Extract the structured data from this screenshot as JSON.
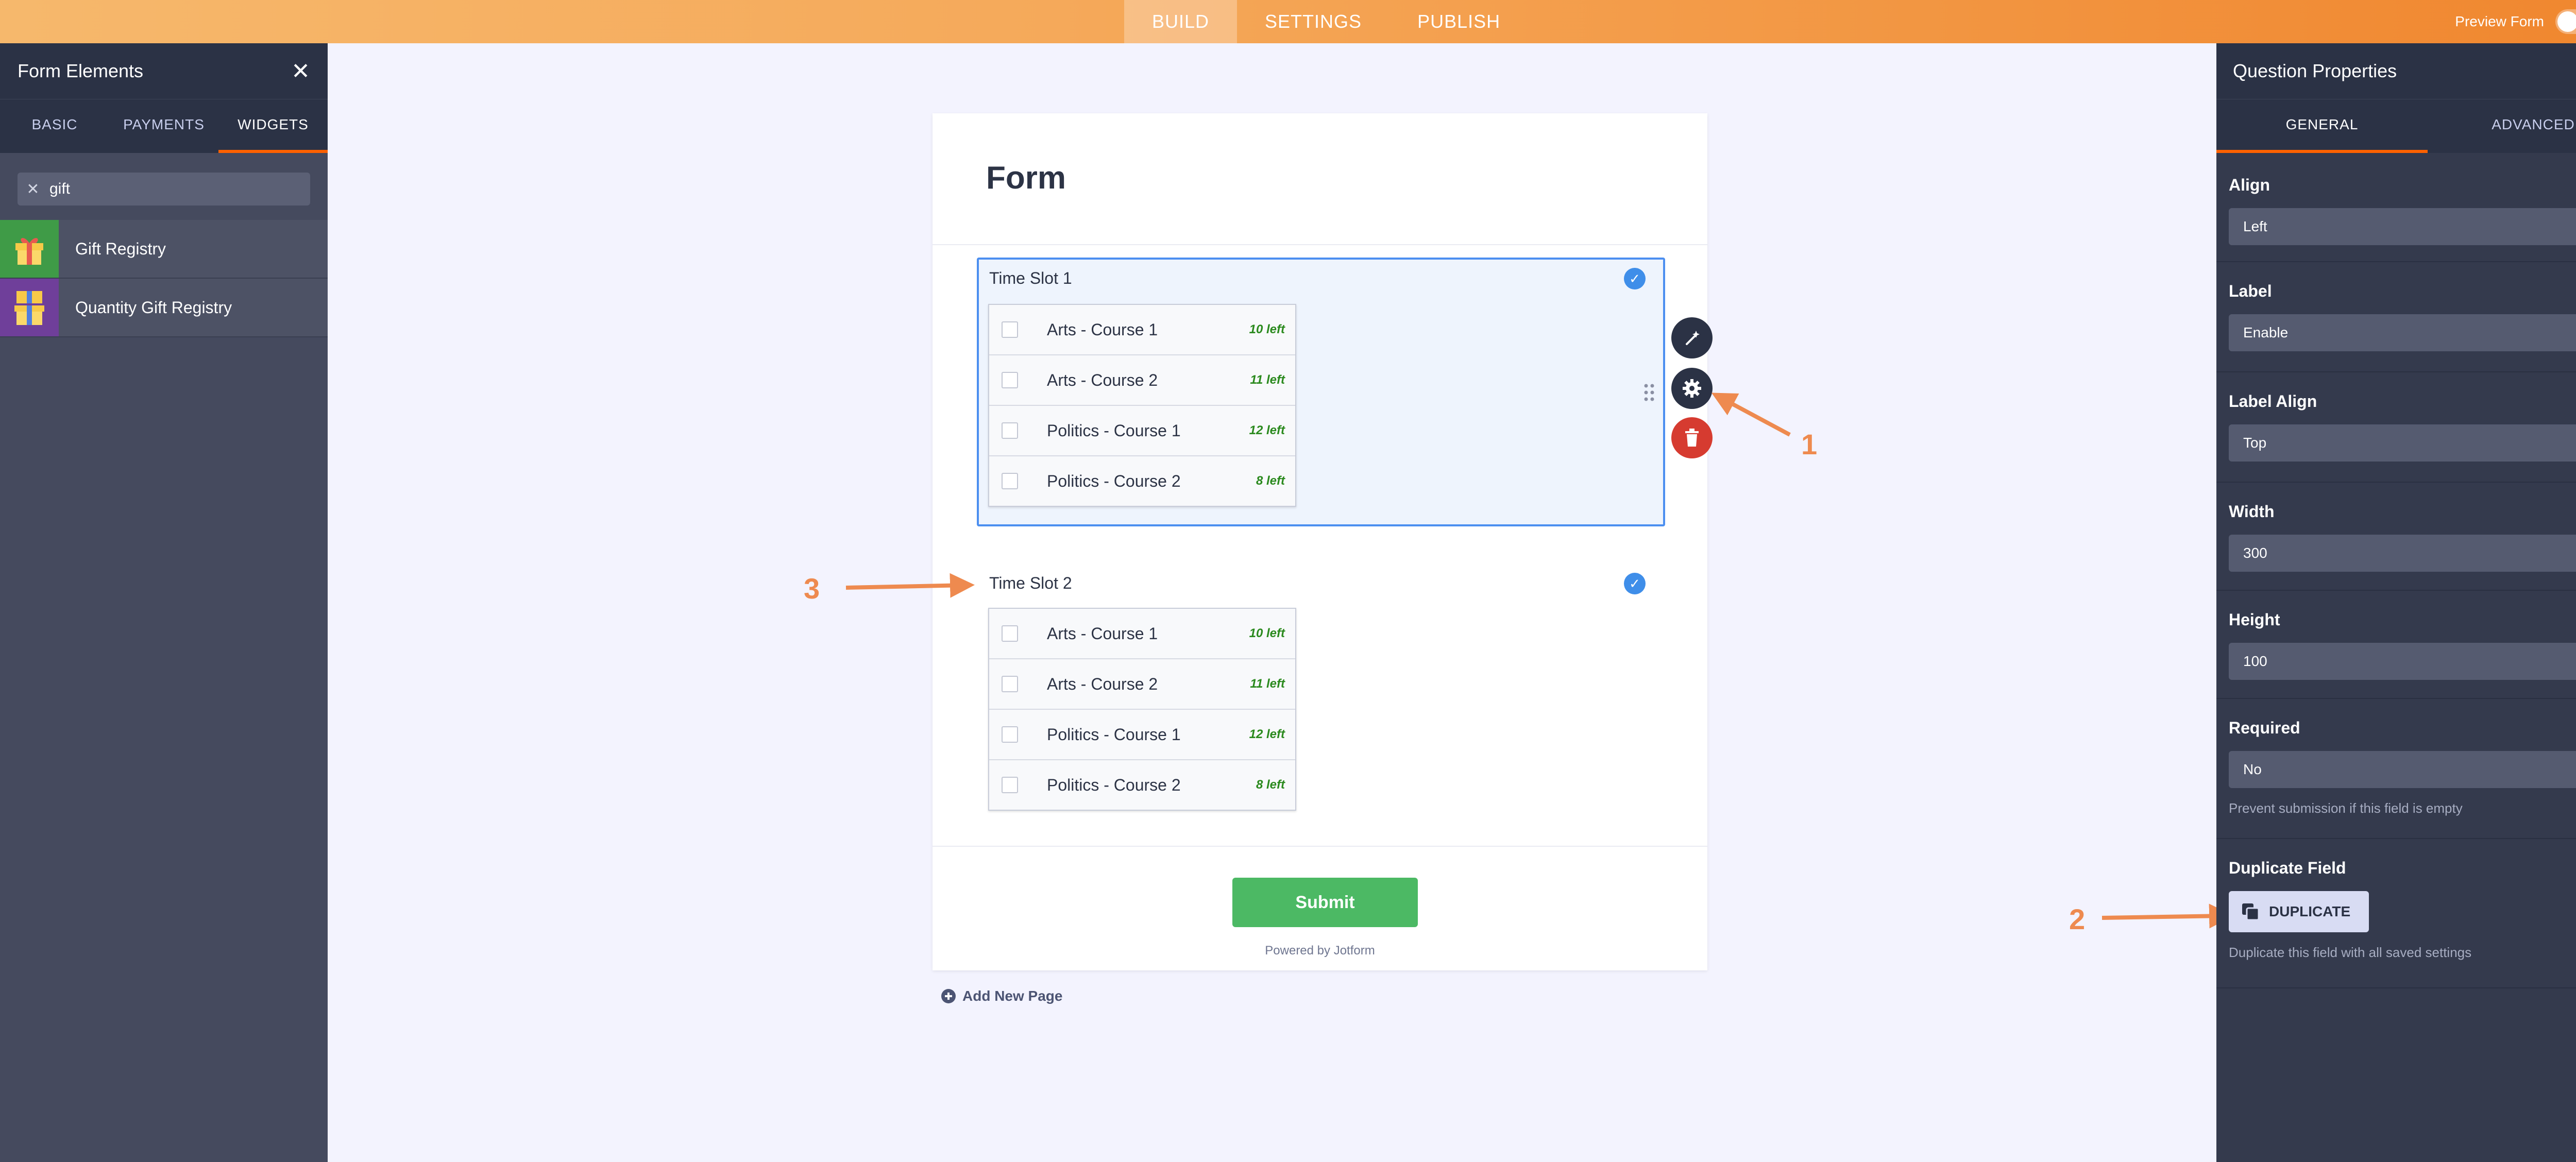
{
  "topbar": {
    "tabs": [
      "BUILD",
      "SETTINGS",
      "PUBLISH"
    ],
    "active_tab": "BUILD",
    "preview_label": "Preview Form"
  },
  "left_panel": {
    "title": "Form Elements",
    "tabs": [
      "BASIC",
      "PAYMENTS",
      "WIDGETS"
    ],
    "active_tab": "WIDGETS",
    "search_value": "gift",
    "items": [
      {
        "label": "Gift Registry",
        "icon": "gift-icon",
        "color": "#3f9b47"
      },
      {
        "label": "Quantity Gift Registry",
        "icon": "gift-stack-icon",
        "color": "#6f3f9a"
      }
    ]
  },
  "form": {
    "title": "Form",
    "fields": [
      {
        "label": "Time Slot 1",
        "options": [
          {
            "label": "Arts - Course 1",
            "remaining": "10 left"
          },
          {
            "label": "Arts - Course 2",
            "remaining": "11 left"
          },
          {
            "label": "Politics - Course 1",
            "remaining": "12 left"
          },
          {
            "label": "Politics - Course 2",
            "remaining": "8 left"
          }
        ]
      },
      {
        "label": "Time Slot 2",
        "options": [
          {
            "label": "Arts - Course 1",
            "remaining": "10 left"
          },
          {
            "label": "Arts - Course 2",
            "remaining": "11 left"
          },
          {
            "label": "Politics - Course 1",
            "remaining": "12 left"
          },
          {
            "label": "Politics - Course 2",
            "remaining": "8 left"
          }
        ]
      }
    ],
    "submit_label": "Submit",
    "powered_by": "Powered by Jotform",
    "add_page_label": "Add New Page"
  },
  "annotations": [
    "1",
    "2",
    "3"
  ],
  "right_panel": {
    "title": "Question Properties",
    "tabs": [
      "GENERAL",
      "ADVANCED"
    ],
    "active_tab": "GENERAL",
    "align": {
      "label": "Align",
      "value": "Left"
    },
    "label_prop": {
      "label": "Label",
      "value": "Enable"
    },
    "label_align": {
      "label": "Label Align",
      "value": "Top"
    },
    "width": {
      "label": "Width",
      "value": "300"
    },
    "height": {
      "label": "Height",
      "value": "100"
    },
    "required": {
      "label": "Required",
      "value": "No",
      "hint": "Prevent submission if this field is empty"
    },
    "duplicate": {
      "label": "Duplicate Field",
      "button": "DUPLICATE",
      "hint": "Duplicate this field with all saved settings"
    }
  },
  "colors": {
    "accent": "#ff6100",
    "selection": "#4c8ff0",
    "submit": "#4cb964",
    "annotation": "#ee8a4f"
  }
}
